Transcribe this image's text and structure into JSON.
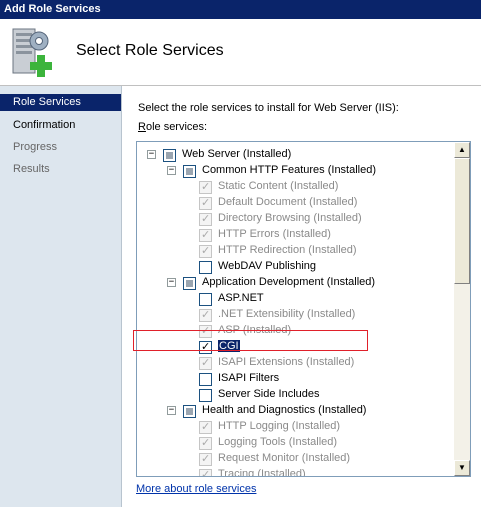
{
  "window": {
    "title": "Add Role Services"
  },
  "header": {
    "title": "Select Role Services"
  },
  "nav": [
    {
      "label": "Role Services",
      "state": "selected"
    },
    {
      "label": "Confirmation",
      "state": "normal"
    },
    {
      "label": "Progress",
      "state": "disabled"
    },
    {
      "label": "Results",
      "state": "disabled"
    }
  ],
  "main": {
    "instruction": "Select the role services to install for Web Server (IIS):",
    "role_services_label_prefix": "R",
    "role_services_label_rest": "ole services:",
    "more_link": "More about role services"
  },
  "tree": [
    {
      "label": "Web Server  (Installed)",
      "level": 0,
      "expander": "−",
      "check": "tri",
      "disabled": false
    },
    {
      "label": "Common HTTP Features  (Installed)",
      "level": 1,
      "expander": "−",
      "check": "tri",
      "disabled": false
    },
    {
      "label": "Static Content  (Installed)",
      "level": 2,
      "check": "checked",
      "disabled": true
    },
    {
      "label": "Default Document  (Installed)",
      "level": 2,
      "check": "checked",
      "disabled": true
    },
    {
      "label": "Directory Browsing  (Installed)",
      "level": 2,
      "check": "checked",
      "disabled": true
    },
    {
      "label": "HTTP Errors  (Installed)",
      "level": 2,
      "check": "checked",
      "disabled": true
    },
    {
      "label": "HTTP Redirection  (Installed)",
      "level": 2,
      "check": "checked",
      "disabled": true
    },
    {
      "label": "WebDAV Publishing",
      "level": 2,
      "check": "empty",
      "disabled": false
    },
    {
      "label": "Application Development  (Installed)",
      "level": 1,
      "expander": "−",
      "check": "tri",
      "disabled": false
    },
    {
      "label": "ASP.NET",
      "level": 2,
      "check": "empty",
      "disabled": false
    },
    {
      "label": ".NET Extensibility  (Installed)",
      "level": 2,
      "check": "checked",
      "disabled": true
    },
    {
      "label": "ASP  (Installed)",
      "level": 2,
      "check": "checked",
      "disabled": true
    },
    {
      "label": "CGI",
      "level": 2,
      "check": "checked",
      "disabled": false,
      "selected": true
    },
    {
      "label": "ISAPI Extensions  (Installed)",
      "level": 2,
      "check": "checked",
      "disabled": true
    },
    {
      "label": "ISAPI Filters",
      "level": 2,
      "check": "empty",
      "disabled": false
    },
    {
      "label": "Server Side Includes",
      "level": 2,
      "check": "empty",
      "disabled": false
    },
    {
      "label": "Health and Diagnostics  (Installed)",
      "level": 1,
      "expander": "−",
      "check": "tri",
      "disabled": false
    },
    {
      "label": "HTTP Logging  (Installed)",
      "level": 2,
      "check": "checked",
      "disabled": true
    },
    {
      "label": "Logging Tools  (Installed)",
      "level": 2,
      "check": "checked",
      "disabled": true
    },
    {
      "label": "Request Monitor  (Installed)",
      "level": 2,
      "check": "checked",
      "disabled": true
    },
    {
      "label": "Tracing  (Installed)",
      "level": 2,
      "check": "checked",
      "disabled": true
    }
  ],
  "icons": {
    "header": "server-roles-add-icon",
    "scroll_up": "scroll-up-arrow-icon",
    "scroll_down": "scroll-down-arrow-icon"
  },
  "colors": {
    "titlebar": "#0a246a",
    "nav_background": "#dde6ee",
    "selection": "#0a246a",
    "highlight_box": "#e0202a",
    "link": "#0033aa"
  }
}
